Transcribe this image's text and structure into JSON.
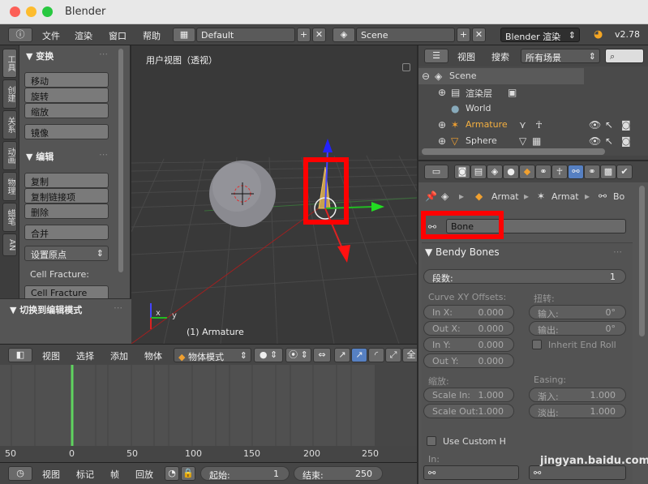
{
  "window": {
    "title": "Blender"
  },
  "topbar": {
    "menus": [
      "文件",
      "渲染",
      "窗口",
      "帮助"
    ],
    "layout": "Default",
    "scene": "Scene",
    "engine": "Blender 渲染",
    "version": "v2.78"
  },
  "toolshelf": {
    "tabs": [
      "工具",
      "创建",
      "关系",
      "动画",
      "物理",
      "蜡笔",
      "AN"
    ],
    "transform": {
      "title": "▼ 变换",
      "buttons": [
        "移动",
        "旋转",
        "缩放",
        "镜像"
      ]
    },
    "edit": {
      "title": "▼ 编辑",
      "buttons": [
        "复制",
        "复制链接项",
        "删除",
        "合并"
      ],
      "origin": "设置原点",
      "cell_label": "Cell Fracture:",
      "cell_button": "Cell Fracture"
    },
    "mode_panel": "▼ 切换到编辑模式"
  },
  "viewport": {
    "view_label": "用户视图（透视）",
    "object_label": "(1) Armature",
    "axis_x": "x",
    "axis_y": "y"
  },
  "viewport_header": {
    "items": [
      "视图",
      "选择",
      "添加",
      "物体"
    ],
    "mode": "物体模式",
    "extra": "全"
  },
  "timeline": {
    "ticks": [
      "50",
      "0",
      "50",
      "100",
      "150",
      "200",
      "250"
    ],
    "menus": [
      "视图",
      "标记",
      "帧",
      "回放"
    ],
    "start_label": "起始:",
    "start": "1",
    "end_label": "结束:",
    "end": "250"
  },
  "outliner": {
    "menus": [
      "视图",
      "搜索"
    ],
    "filter": "所有场景",
    "items": [
      {
        "label": "Scene"
      },
      {
        "label": "渲染层"
      },
      {
        "label": "World"
      },
      {
        "label": "Armature"
      },
      {
        "label": "Sphere"
      }
    ]
  },
  "properties": {
    "breadcrumb": [
      "Armat",
      "Armat",
      "Bo"
    ],
    "bone_name": "Bone",
    "bendy": {
      "title": "▼ Bendy Bones",
      "segments_label": "段数:",
      "segments": "1",
      "curve_xy": "Curve XY Offsets:",
      "roll": "扭转:",
      "in_x_label": "In X:",
      "in_x": "0.000",
      "out_x_label": "Out X:",
      "out_x": "0.000",
      "in_y_label": "In Y:",
      "in_y": "0.000",
      "out_y_label": "Out Y:",
      "out_y": "0.000",
      "roll_in_label": "输入:",
      "roll_in": "0°",
      "roll_out_label": "输出:",
      "roll_out": "0°",
      "inherit": "Inherit End Roll",
      "scale": "缩放:",
      "easing": "Easing:",
      "scale_in_label": "Scale In:",
      "scale_in": "1.000",
      "scale_out_label": "Scale Out:",
      "scale_out": "1.000",
      "ease_in_label": "渐入:",
      "ease_in": "1.000",
      "ease_out_label": "淡出:",
      "ease_out": "1.000",
      "custom": "Use Custom H",
      "in_label": "In:"
    }
  },
  "watermark": "jingyan.baidu.com",
  "colors": {
    "highlight": "#ff0000",
    "frame_marker": "#5fd35f",
    "active_bone": "#e8a030"
  }
}
